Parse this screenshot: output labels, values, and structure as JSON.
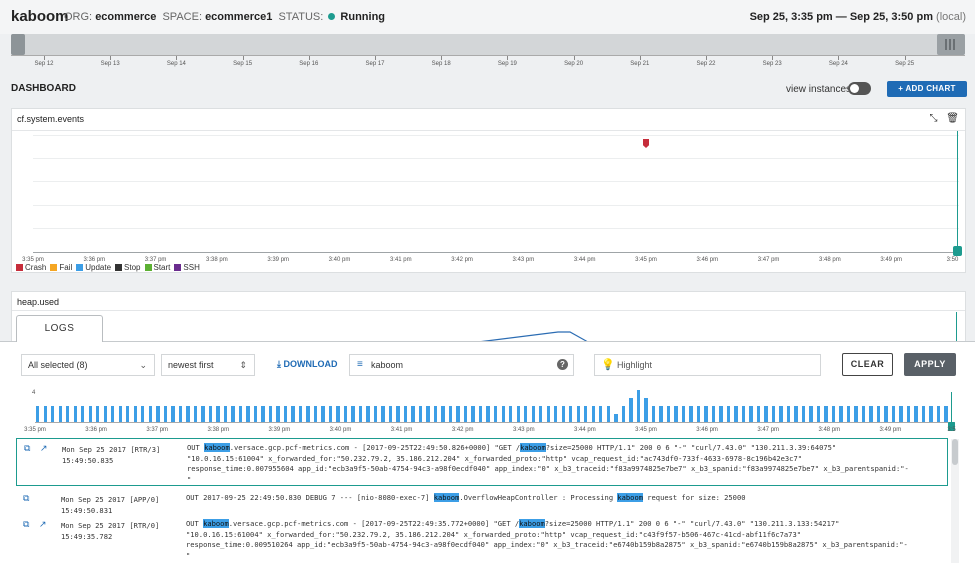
{
  "header": {
    "app": "kaboom",
    "org_label": "ORG:",
    "org": "ecommerce",
    "space_label": "SPACE:",
    "space": "ecommerce1",
    "status_label": "STATUS:",
    "status": "Running",
    "range": "Sep 25, 3:35 pm — Sep 25, 3:50 pm",
    "range_suffix": "(local)"
  },
  "timeline": {
    "labels": [
      "Sep 12",
      "Sep 13",
      "Sep 14",
      "Sep 15",
      "Sep 16",
      "Sep 17",
      "Sep 18",
      "Sep 19",
      "Sep 20",
      "Sep 21",
      "Sep 22",
      "Sep 23",
      "Sep 24",
      "Sep 25"
    ]
  },
  "dashboard": {
    "title": "DASHBOARD",
    "view_instances": "view instances",
    "view_instances_on": false,
    "add_chart": "+ ADD CHART"
  },
  "chart_data": [
    {
      "type": "scatter",
      "title": "cf.system.events",
      "categories": [
        "3:35 pm",
        "3:36 pm",
        "3:37 pm",
        "3:38 pm",
        "3:39 pm",
        "3:40 pm",
        "3:41 pm",
        "3:42 pm",
        "3:43 pm",
        "3:44 pm",
        "3:45 pm",
        "3:46 pm",
        "3:47 pm",
        "3:48 pm",
        "3:49 pm",
        "3:50"
      ],
      "series": [
        {
          "name": "Crash",
          "color": "#c62d3b",
          "x": [
            "3:45 pm"
          ]
        },
        {
          "name": "Fail",
          "color": "#f5a623",
          "x": []
        },
        {
          "name": "Update",
          "color": "#3c9ee6",
          "x": []
        },
        {
          "name": "Stop",
          "color": "#333333",
          "x": []
        },
        {
          "name": "Start",
          "color": "#5cb033",
          "x": []
        },
        {
          "name": "SSH",
          "color": "#6a2c8e",
          "x": []
        }
      ],
      "grid": true
    },
    {
      "type": "bar",
      "categories": [
        "3:35 pm",
        "3:36 pm",
        "3:37 pm",
        "3:38 pm",
        "3:39 pm",
        "3:40 pm",
        "3:41 pm",
        "3:42 pm",
        "3:43 pm",
        "3:44 pm",
        "3:45 pm",
        "3:46 pm",
        "3:47 pm",
        "3:48 pm",
        "3:49 pm",
        "3:5"
      ],
      "values": [
        2,
        2,
        2,
        2,
        2,
        2,
        2,
        2,
        2,
        2,
        2,
        2,
        2,
        2,
        2,
        2,
        2,
        2,
        2,
        2,
        2,
        2,
        2,
        2,
        2,
        2,
        2,
        2,
        2,
        2,
        2,
        2,
        2,
        2,
        2,
        2,
        2,
        2,
        2,
        2,
        2,
        2,
        2,
        2,
        2,
        2,
        2,
        2,
        2,
        2,
        2,
        2,
        2,
        2,
        2,
        2,
        2,
        2,
        2,
        2,
        2,
        2,
        2,
        2,
        2,
        2,
        2,
        2,
        2,
        2,
        2,
        2,
        2,
        2,
        2,
        2,
        2,
        1,
        2,
        3,
        4,
        3,
        2,
        2,
        2,
        2,
        2,
        2,
        2,
        2,
        2,
        2,
        2,
        2,
        2,
        2,
        2,
        2,
        2,
        2,
        2,
        2,
        2,
        2,
        2,
        2,
        2,
        2,
        2,
        2,
        2,
        2,
        2,
        2,
        2,
        2,
        2,
        2,
        2,
        2,
        2,
        2
      ],
      "ylim": [
        0,
        4
      ],
      "yticks": [
        "4"
      ],
      "color": "#3c9ee6"
    }
  ],
  "heap_panel": {
    "title": "heap.used"
  },
  "logs": {
    "tab": "LOGS",
    "filter_select": "All selected (8)",
    "sort_select": "newest first",
    "download": "DOWNLOAD",
    "search_value": "kaboom",
    "highlight_placeholder": "Highlight",
    "clear": "CLEAR",
    "apply": "APPLY",
    "rows": [
      {
        "date": "Mon Sep 25 2017",
        "source": "[RTR/3]",
        "time": "15:49:50.835",
        "selected": true,
        "has_link": true,
        "lines": [
          [
            "OUT ",
            {
              "hl": "kaboom"
            },
            ".versace.gcp.pcf-metrics.com - [2017-09-25T22:49:50.826+0000] \"GET /",
            {
              "hl": "kaboom"
            },
            "?size=25000 HTTP/1.1\" 200 0 6 \"-\" \"curl/7.43.0\" \"130.211.3.39:64075\""
          ],
          [
            "\"10.0.16.15:61004\" x_forwarded_for:\"50.232.79.2, 35.186.212.204\" x_forwarded_proto:\"http\" vcap_request_id:\"ac743df0-733f-4633-6978-8c196b42e3c7\""
          ],
          [
            "response_time:0.007955604 app_id:\"ecb3a9f5-50ab-4754-94c3-a98f0ecdf040\" app_index:\"0\" x_b3_traceid:\"f83a9974825e7be7\" x_b3_spanid:\"f83a9974825e7be7\" x_b3_parentspanid:\"-"
          ],
          [
            "\""
          ]
        ]
      },
      {
        "date": "Mon Sep 25 2017",
        "source": "[APP/0]",
        "time": "15:49:50.831",
        "selected": false,
        "has_link": false,
        "lines": [
          [
            "OUT 2017-09-25 22:49:50.830 DEBUG 7 --- [nio-8080-exec-7] ",
            {
              "hl": "kaboom"
            },
            ".OverflowHeapController : Processing ",
            {
              "hl": "kaboom"
            },
            " request for size: 25000"
          ]
        ]
      },
      {
        "date": "Mon Sep 25 2017",
        "source": "[RTR/0]",
        "time": "15:49:35.782",
        "selected": false,
        "has_link": true,
        "lines": [
          [
            "OUT ",
            {
              "hl": "kaboom"
            },
            ".versace.gcp.pcf-metrics.com - [2017-09-25T22:49:35.772+0000] \"GET /",
            {
              "hl": "kaboom"
            },
            "?size=25000 HTTP/1.1\" 200 0 6 \"-\" \"curl/7.43.0\" \"130.211.3.133:54217\""
          ],
          [
            "\"10.0.16.15:61004\" x_forwarded_for:\"50.232.79.2, 35.186.212.204\" x_forwarded_proto:\"http\" vcap_request_id:\"c43f9f57-b506-467c-41cd-abf11f6c7a73\""
          ],
          [
            "response_time:0.009510264 app_id:\"ecb3a9f5-50ab-4754-94c3-a98f0ecdf040\" app_index:\"0\" x_b3_traceid:\"e6740b159b8a2875\" x_b3_spanid:\"e6740b159b8a2875\" x_b3_parentspanid:\"-"
          ],
          [
            "\""
          ]
        ]
      }
    ]
  }
}
